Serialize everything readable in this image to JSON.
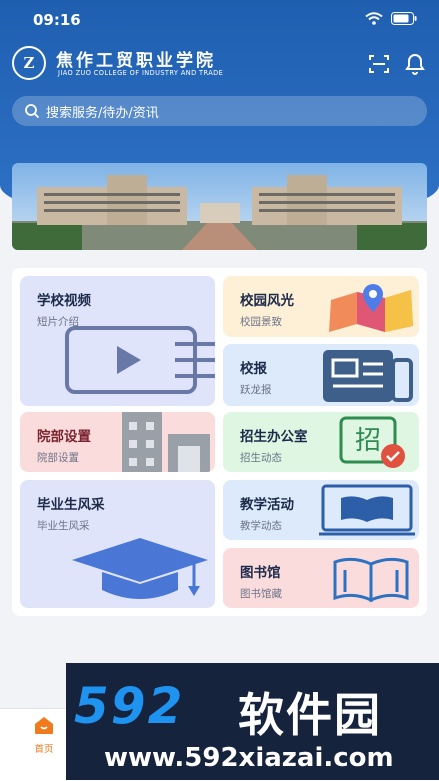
{
  "status_bar": {
    "time": "09:16"
  },
  "header": {
    "logo_mark": "Z",
    "school_name_cn": "焦作工贸职业学院",
    "school_name_en": "JIAO ZUO COLLEGE OF INDUSTRY AND TRADE",
    "icons": [
      "scan-icon",
      "bell-icon"
    ]
  },
  "search": {
    "placeholder": "搜索服务/待办/资讯"
  },
  "cards": [
    {
      "title": "学校视频",
      "subtitle": "短片介绍",
      "icon": "video-play-icon",
      "color": "#dfe4fb"
    },
    {
      "title": "校园风光",
      "subtitle": "校园景致",
      "icon": "map-pin-icon",
      "color": "#fdf0d7"
    },
    {
      "title": "校报",
      "subtitle": "跃龙报",
      "icon": "newspaper-icon",
      "color": "#ddeafb"
    },
    {
      "title": "院部设置",
      "subtitle": "院部设置",
      "icon": "building-icon",
      "color": "#fbdcdc"
    },
    {
      "title": "招生办公室",
      "subtitle": "招生动态",
      "icon": "recruit-stamp-icon",
      "color": "#def6e2"
    },
    {
      "title": "毕业生风采",
      "subtitle": "毕业生风采",
      "icon": "graduation-cap-icon",
      "color": "#dfe4fb"
    },
    {
      "title": "教学活动",
      "subtitle": "教学动态",
      "icon": "book-screen-icon",
      "color": "#ddeafb"
    },
    {
      "title": "图书馆",
      "subtitle": "图书馆藏",
      "icon": "open-book-icon",
      "color": "#fbdcdc"
    }
  ],
  "bottom_nav": {
    "home_label": "首页",
    "home_icon": "home-icon",
    "accent": "#f07a1e"
  },
  "watermark": {
    "brand_num": "592",
    "brand_cn": "软件园",
    "url": "www.592xiazai.com"
  }
}
